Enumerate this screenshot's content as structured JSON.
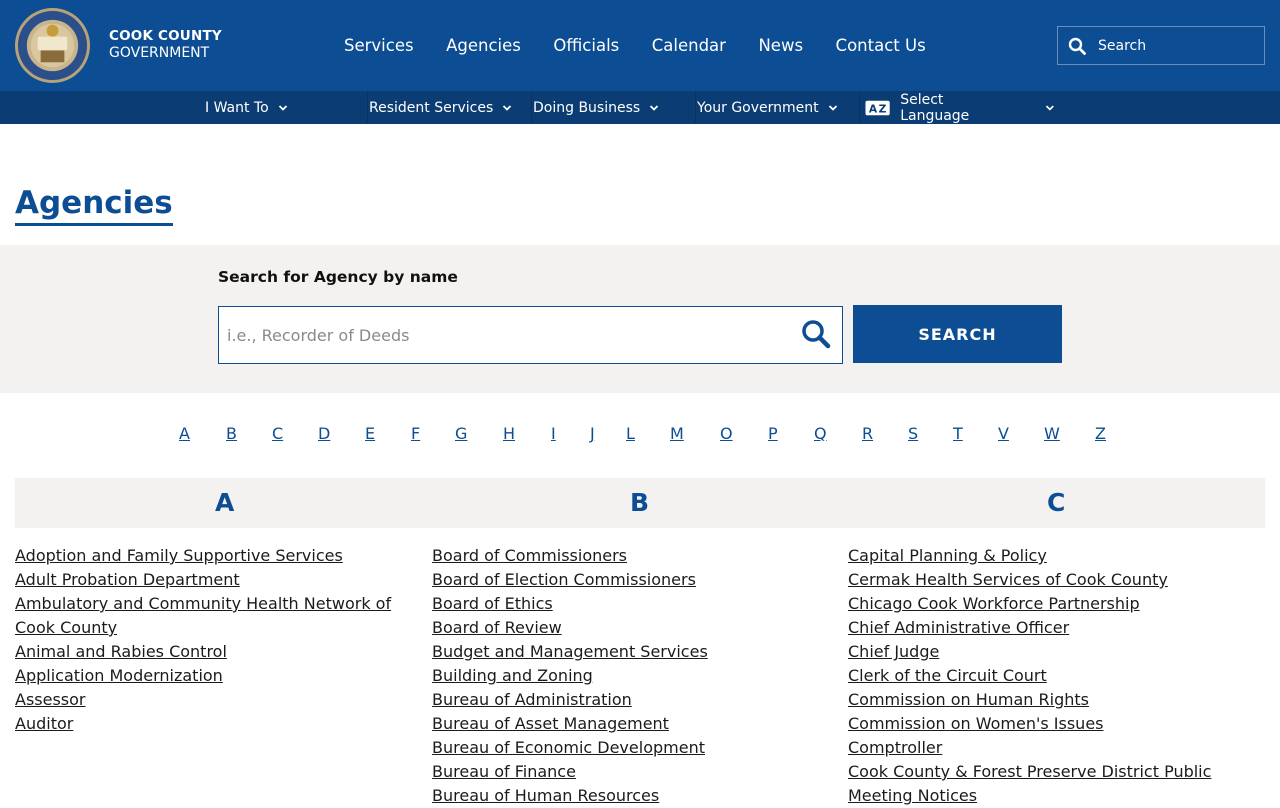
{
  "header": {
    "brand_line1": "COOK COUNTY",
    "brand_line2": "GOVERNMENT",
    "nav": [
      "Services",
      "Agencies",
      "Officials",
      "Calendar",
      "News",
      "Contact Us"
    ],
    "search_placeholder": "Search"
  },
  "subnav": {
    "items": [
      "I Want To",
      "Resident Services",
      "Doing Business",
      "Your Government"
    ],
    "language": "Select Language"
  },
  "page": {
    "title": "Agencies",
    "search_label": "Search for Agency by name",
    "search_placeholder": "i.e., Recorder of Deeds",
    "search_button": "SEARCH"
  },
  "alphabet": [
    "A",
    "B",
    "C",
    "D",
    "E",
    "F",
    "G",
    "H",
    "I",
    "J",
    "L",
    "M",
    "O",
    "P",
    "Q",
    "R",
    "S",
    "T",
    "V",
    "W",
    "Z"
  ],
  "columns": [
    {
      "letter": "A",
      "items": [
        "Adoption and Family Supportive Services",
        "Adult Probation Department",
        "Ambulatory and Community Health Network of Cook County",
        "Animal and Rabies Control",
        "Application Modernization",
        "Assessor",
        "Auditor"
      ]
    },
    {
      "letter": "B",
      "items": [
        "Board of Commissioners",
        "Board of Election Commissioners",
        "Board of Ethics",
        "Board of Review",
        "Budget and Management Services",
        "Building and Zoning",
        "Bureau of Administration",
        "Bureau of Asset Management",
        "Bureau of Economic Development",
        "Bureau of Finance",
        "Bureau of Human Resources"
      ]
    },
    {
      "letter": "C",
      "items": [
        "Capital Planning & Policy",
        "Cermak Health Services of Cook County",
        "Chicago Cook Workforce Partnership",
        "Chief Administrative Officer",
        "Chief Judge",
        "Clerk of the Circuit Court",
        "Commission on Human Rights",
        "Commission on Women's Issues",
        "Comptroller",
        "Cook County & Forest Preserve District Public Meeting Notices"
      ]
    }
  ],
  "colors": {
    "brand_blue": "#0c4d93",
    "subnav_blue": "#0b3d74",
    "band_gray": "#f3f2f1"
  },
  "icons": [
    "county-seal-logo",
    "search-icon",
    "chevron-down-icon",
    "translate-icon",
    "magnifier-icon"
  ]
}
